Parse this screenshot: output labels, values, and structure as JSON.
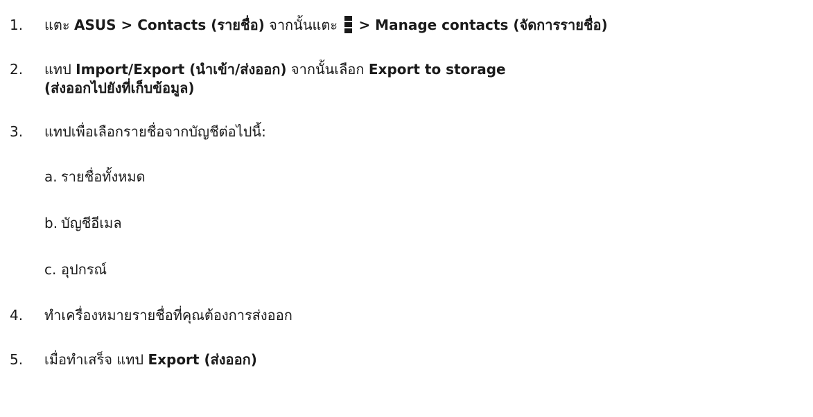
{
  "steps": {
    "s1": {
      "num": "1.",
      "t1": "แตะ ",
      "b1": "ASUS > Contacts (รายชื่อ)",
      "t2": " จากนั้นแตะ ",
      "icon": "three-dot-menu-icon",
      "b2": " > Manage contacts (จัดการรายชื่อ)"
    },
    "s2": {
      "num": "2.",
      "t1": "แทป ",
      "b1": "Import/Export (นำเข้า/ส่งออก)",
      "t2": " จากนั้นเลือก ",
      "b2": "Export to storage",
      "b3": "(ส่งออกไปยังที่เก็บข้อมูล)"
    },
    "s3": {
      "num": "3.",
      "t1": "แทปเพื่อเลือกรายชื่อจากบัญชีต่อไปนี้:"
    },
    "sub": [
      {
        "num": "a.",
        "text": "รายชื่อทั้งหมด"
      },
      {
        "num": "b.",
        "text": "บัญชีอีเมล"
      },
      {
        "num": "c.",
        "text": "อุปกรณ์"
      }
    ],
    "s4": {
      "num": "4.",
      "t1": "ทำเครื่องหมายรายชื่อที่คุณต้องการส่งออก"
    },
    "s5": {
      "num": "5.",
      "t1": "เมื่อทำเสร็จ แทป ",
      "b1": "Export (ส่งออก)"
    }
  }
}
